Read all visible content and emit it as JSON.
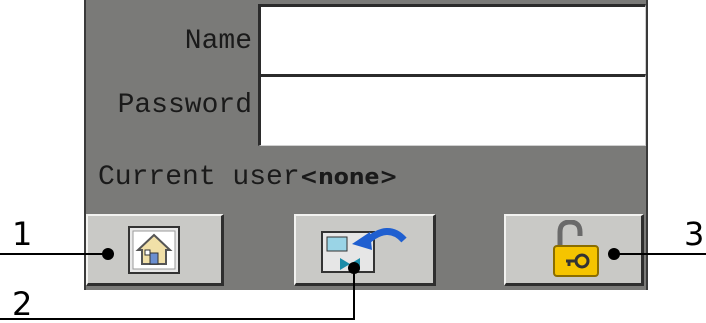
{
  "form": {
    "name_label": "Name",
    "name_value": "",
    "password_label": "Password",
    "password_value": "",
    "current_user_label": "Current user",
    "current_user_value": "<none>"
  },
  "toolbar": {
    "buttons": [
      {
        "name": "home",
        "icon": "home-icon"
      },
      {
        "name": "switch-user",
        "icon": "switch-user-icon"
      },
      {
        "name": "logout",
        "icon": "unlock-icon"
      }
    ]
  },
  "callouts": [
    "1",
    "2",
    "3"
  ],
  "colors": {
    "panel": "#7a7a78",
    "button": "#c9c9c6",
    "lock_yellow": "#f5c400"
  }
}
